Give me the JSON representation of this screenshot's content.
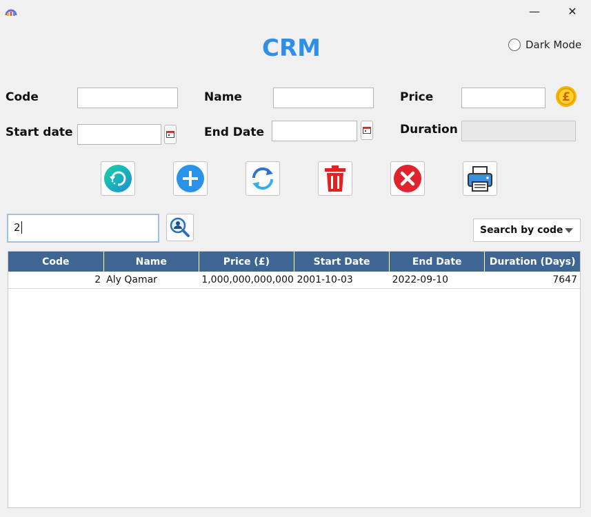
{
  "window": {
    "minimize_icon": "minimize-icon",
    "close_icon": "close-icon",
    "minimize_glyph": "—",
    "close_glyph": "✕"
  },
  "header": {
    "title": "CRM",
    "dark_mode_label": "Dark Mode",
    "dark_mode_checked": false
  },
  "form": {
    "code_label": "Code",
    "code_value": "",
    "name_label": "Name",
    "name_value": "",
    "price_label": "Price",
    "price_value": "",
    "start_date_label": "Start date",
    "start_date_value": "",
    "end_date_label": "End Date",
    "end_date_value": "",
    "duration_label": "Duration",
    "duration_value": ""
  },
  "toolbar": {
    "buttons": [
      {
        "name": "refresh",
        "icon": "refresh-circle-icon"
      },
      {
        "name": "add",
        "icon": "plus-circle-icon"
      },
      {
        "name": "update",
        "icon": "sync-icon"
      },
      {
        "name": "delete",
        "icon": "trash-icon"
      },
      {
        "name": "clear",
        "icon": "x-circle-icon"
      },
      {
        "name": "print",
        "icon": "printer-icon"
      }
    ]
  },
  "search": {
    "value": "2",
    "button_icon": "user-search-icon",
    "mode_selected": "Search by code"
  },
  "table": {
    "columns": [
      "Code",
      "Name",
      "Price (£)",
      "Start Date",
      "End Date",
      "Duration (Days)"
    ],
    "rows": [
      [
        "2",
        "Aly Qamar",
        "1,000,000,000,000",
        "2001-10-03",
        "2022-09-10",
        "7647"
      ]
    ]
  },
  "colors": {
    "title": "#2e8fe6",
    "table_header": "#3f6592",
    "coin": "#f5b400"
  }
}
